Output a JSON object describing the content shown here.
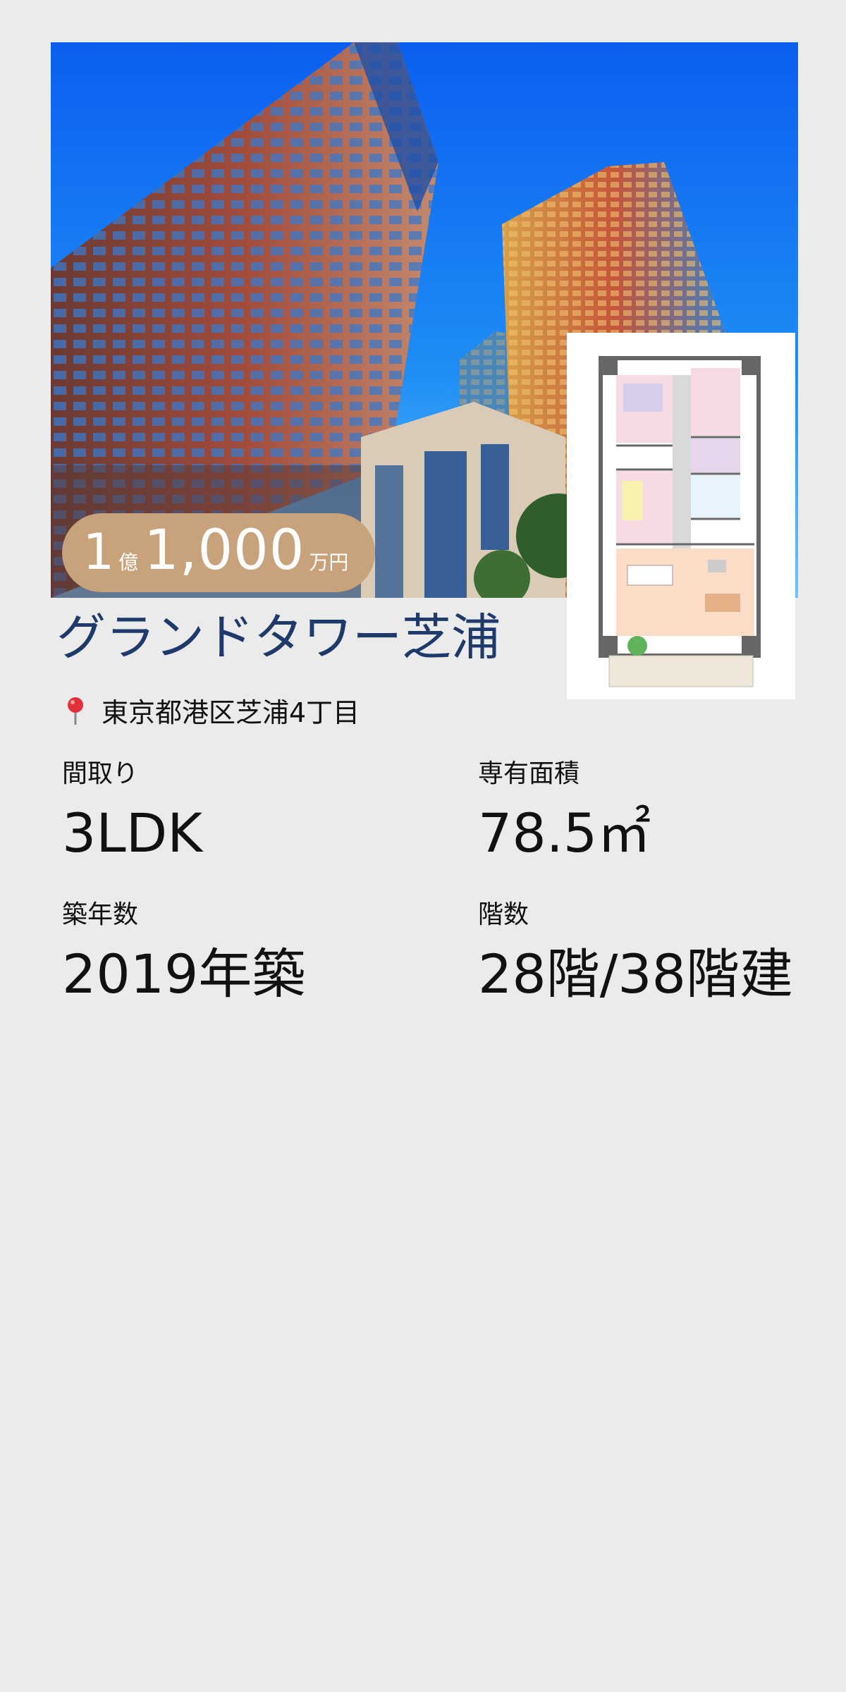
{
  "property": {
    "name": "グランドタワー芝浦",
    "address": "東京都港区芝浦4丁目",
    "price": {
      "oku": "1",
      "oku_unit": "億",
      "man": "1,000",
      "man_unit": "万円"
    },
    "specs": [
      {
        "label": "間取り",
        "value": "3LDK"
      },
      {
        "label": "専有面積",
        "value": "78.5㎡"
      },
      {
        "label": "築年数",
        "value": "2019年築"
      },
      {
        "label": "階数",
        "value": "28階/38階建"
      }
    ]
  },
  "icons": {
    "location": "map-pin-icon"
  },
  "colors": {
    "title": "#1e3a6a",
    "price_badge": "#c7a27b",
    "background": "#ebebeb"
  }
}
